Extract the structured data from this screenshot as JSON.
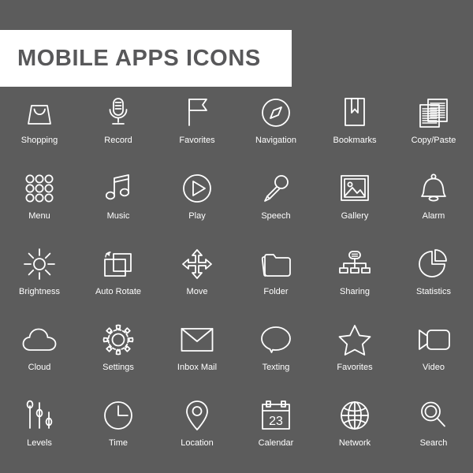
{
  "page": {
    "background_color": "#5c5c5c",
    "icon_color": "#ffffff",
    "banner_background": "#ffffff",
    "banner_text_color": "#58585a"
  },
  "header": {
    "title": "MOBILE APPS ICONS"
  },
  "grid": {
    "columns": 6,
    "rows": 5,
    "icons": [
      {
        "label": "Shopping",
        "icon": "shopping-bag-icon"
      },
      {
        "label": "Record",
        "icon": "microphone-stand-icon"
      },
      {
        "label": "Favorites",
        "icon": "flag-icon"
      },
      {
        "label": "Navigation",
        "icon": "compass-icon"
      },
      {
        "label": "Bookmarks",
        "icon": "bookmark-page-icon"
      },
      {
        "label": "Copy/Paste",
        "icon": "documents-stack-icon"
      },
      {
        "label": "Menu",
        "icon": "grid-dots-icon"
      },
      {
        "label": "Music",
        "icon": "music-note-icon"
      },
      {
        "label": "Play",
        "icon": "play-circle-icon"
      },
      {
        "label": "Speech",
        "icon": "handheld-microphone-icon"
      },
      {
        "label": "Gallery",
        "icon": "photo-frame-icon"
      },
      {
        "label": "Alarm",
        "icon": "bell-icon"
      },
      {
        "label": "Brightness",
        "icon": "sun-icon"
      },
      {
        "label": "Auto Rotate",
        "icon": "screen-rotate-icon"
      },
      {
        "label": "Move",
        "icon": "four-arrows-icon"
      },
      {
        "label": "Folder",
        "icon": "folder-icon"
      },
      {
        "label": "Sharing",
        "icon": "hierarchy-network-icon"
      },
      {
        "label": "Statistics",
        "icon": "pie-chart-icon"
      },
      {
        "label": "Cloud",
        "icon": "cloud-icon"
      },
      {
        "label": "Settings",
        "icon": "gear-icon"
      },
      {
        "label": "Inbox Mail",
        "icon": "envelope-icon"
      },
      {
        "label": "Texting",
        "icon": "speech-bubble-icon"
      },
      {
        "label": "Favorites",
        "icon": "star-icon"
      },
      {
        "label": "Video",
        "icon": "video-camera-icon"
      },
      {
        "label": "Levels",
        "icon": "sliders-icon"
      },
      {
        "label": "Time",
        "icon": "clock-icon"
      },
      {
        "label": "Location",
        "icon": "map-pin-icon"
      },
      {
        "label": "Calendar",
        "icon": "calendar-icon",
        "day": "23"
      },
      {
        "label": "Network",
        "icon": "globe-icon"
      },
      {
        "label": "Search",
        "icon": "magnifier-icon"
      }
    ]
  }
}
